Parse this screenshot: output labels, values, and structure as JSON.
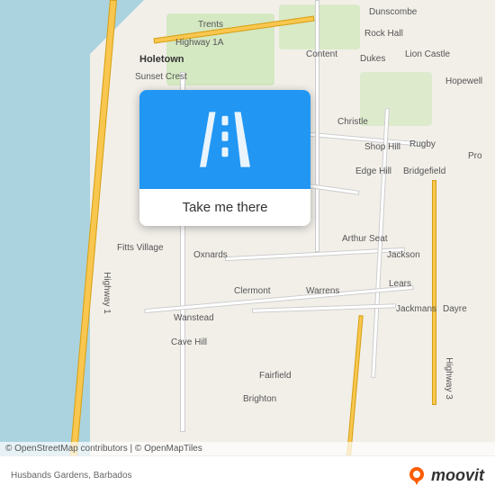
{
  "map": {
    "title": "Husbands Gardens, Barbados",
    "attribution": "© OpenStreetMap contributors | © OpenMapTiles",
    "center": "Husbands Gardens"
  },
  "tooltip": {
    "button_label": "Take me there",
    "icon_name": "road-icon"
  },
  "bottom_bar": {
    "location_text": "Husbands Gardens, Barbados",
    "attribution_text": "© OpenStreetMap contributors | © OpenMapTiles"
  },
  "moovit": {
    "logo_text": "moovit"
  },
  "map_labels": [
    {
      "id": "holetown",
      "text": "Holetown",
      "bold": true
    },
    {
      "id": "highway1a",
      "text": "Highway 1A",
      "bold": false
    },
    {
      "id": "sunset_crest",
      "text": "Sunset Crest",
      "bold": false
    },
    {
      "id": "trents",
      "text": "Trents",
      "bold": false
    },
    {
      "id": "dunscombe",
      "text": "Dunscombe",
      "bold": false
    },
    {
      "id": "rock_hall",
      "text": "Rock Hall",
      "bold": false
    },
    {
      "id": "content",
      "text": "Content",
      "bold": false
    },
    {
      "id": "dukes",
      "text": "Dukes",
      "bold": false
    },
    {
      "id": "lion_castle",
      "text": "Lion Castle",
      "bold": false
    },
    {
      "id": "hopewell",
      "text": "Hopewell",
      "bold": false
    },
    {
      "id": "christle",
      "text": "Christle",
      "bold": false
    },
    {
      "id": "shop_hill",
      "text": "Shop Hill",
      "bold": false
    },
    {
      "id": "rugby",
      "text": "Rugby",
      "bold": false
    },
    {
      "id": "edge_hill",
      "text": "Edge Hill",
      "bold": false
    },
    {
      "id": "bridgefield",
      "text": "Bridgefield",
      "bold": false
    },
    {
      "id": "fitts_village",
      "text": "Fitts Village",
      "bold": false
    },
    {
      "id": "oxnards",
      "text": "Oxnards",
      "bold": false
    },
    {
      "id": "arthur_seat",
      "text": "Arthur Seat",
      "bold": false
    },
    {
      "id": "jackson",
      "text": "Jackson",
      "bold": false
    },
    {
      "id": "clermont",
      "text": "Clermont",
      "bold": false
    },
    {
      "id": "warrens",
      "text": "Warrens",
      "bold": false
    },
    {
      "id": "lears",
      "text": "Lears",
      "bold": false
    },
    {
      "id": "jackmans",
      "text": "Jackmans",
      "bold": false
    },
    {
      "id": "dayre",
      "text": "Dayre",
      "bold": false
    },
    {
      "id": "wanstead",
      "text": "Wanstead",
      "bold": false
    },
    {
      "id": "cave_hill",
      "text": "Cave Hill",
      "bold": false
    },
    {
      "id": "brighton",
      "text": "Brighton",
      "bold": false
    },
    {
      "id": "fairfield",
      "text": "Fairfield",
      "bold": false
    },
    {
      "id": "highway1",
      "text": "Highway 1",
      "bold": false
    },
    {
      "id": "highway3",
      "text": "Highway 3",
      "bold": false
    },
    {
      "id": "pro",
      "text": "Pro",
      "bold": false
    }
  ]
}
